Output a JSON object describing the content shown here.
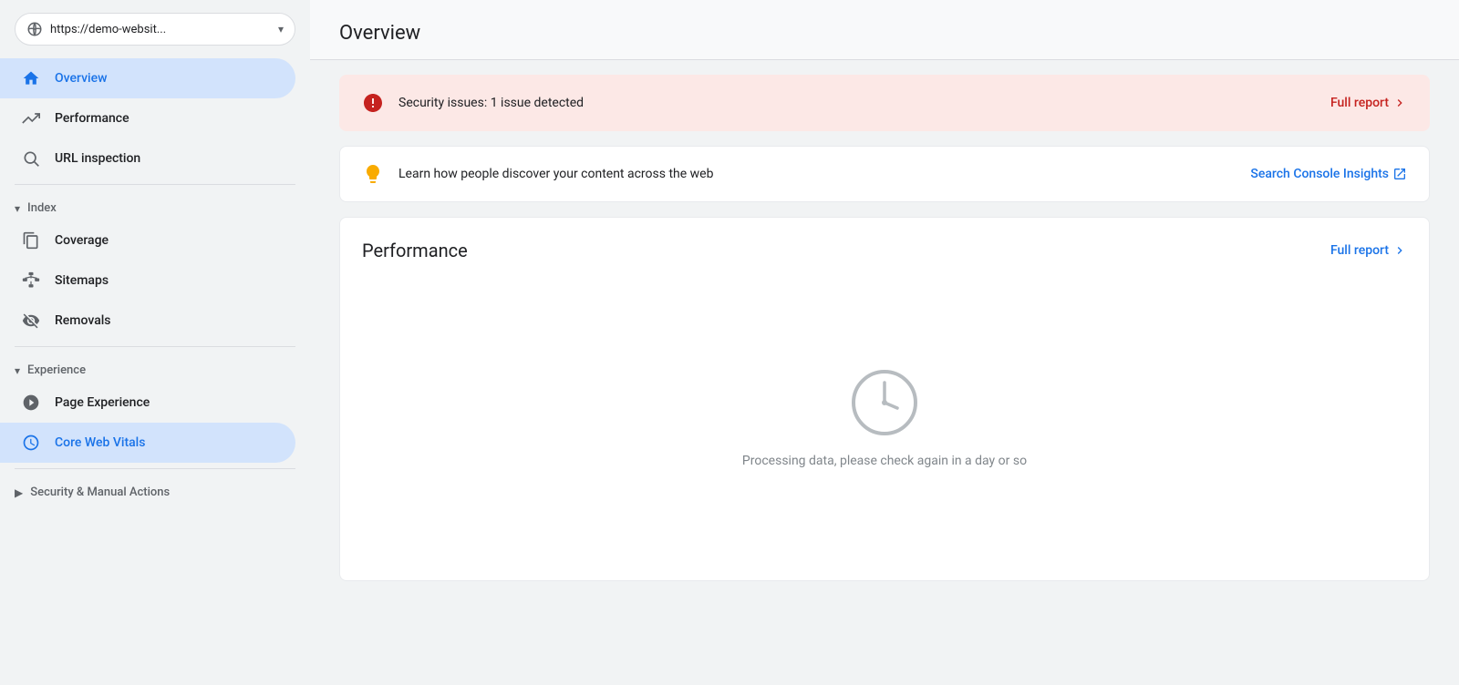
{
  "sidebar": {
    "url": {
      "text": "https://demo-websit...",
      "full": "https://demo-websit..."
    },
    "nav": [
      {
        "id": "overview",
        "label": "Overview",
        "icon": "home",
        "active": true,
        "indent": false
      },
      {
        "id": "performance",
        "label": "Performance",
        "icon": "trending-up",
        "active": false,
        "indent": false
      },
      {
        "id": "url-inspection",
        "label": "URL inspection",
        "icon": "search",
        "active": false,
        "indent": false
      }
    ],
    "sections": [
      {
        "id": "index",
        "label": "Index",
        "expanded": true,
        "items": [
          {
            "id": "coverage",
            "label": "Coverage",
            "icon": "file-copy",
            "active": false
          },
          {
            "id": "sitemaps",
            "label": "Sitemaps",
            "icon": "sitemap",
            "active": false
          },
          {
            "id": "removals",
            "label": "Removals",
            "icon": "visibility-off",
            "active": false
          }
        ]
      },
      {
        "id": "experience",
        "label": "Experience",
        "expanded": true,
        "items": [
          {
            "id": "page-experience",
            "label": "Page Experience",
            "icon": "monitor",
            "active": false
          },
          {
            "id": "core-web-vitals",
            "label": "Core Web Vitals",
            "icon": "speed",
            "active": true
          }
        ]
      },
      {
        "id": "security",
        "label": "Security & Manual Actions",
        "expanded": false,
        "items": []
      }
    ]
  },
  "header": {
    "title": "Overview"
  },
  "alerts": {
    "security": {
      "text": "Security issues: 1 issue detected",
      "link": "Full report",
      "icon": "error"
    },
    "insights": {
      "text": "Learn how people discover your content across the web",
      "link": "Search Console Insights",
      "icon": "lightbulb"
    }
  },
  "performance": {
    "title": "Performance",
    "link": "Full report",
    "status": "Processing data, please check again in a day or so"
  }
}
